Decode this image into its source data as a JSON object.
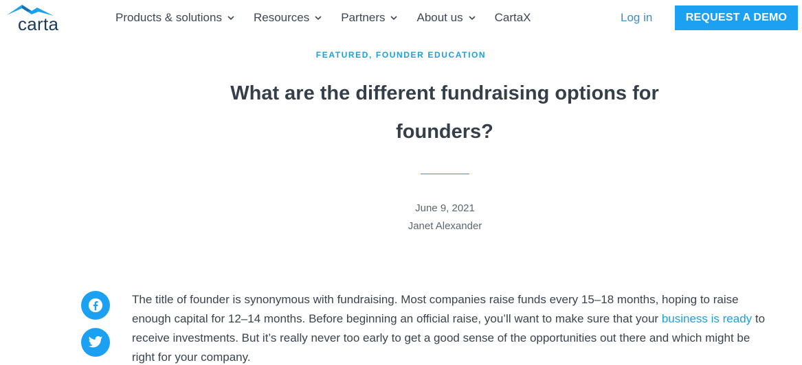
{
  "brand": {
    "name": "carta",
    "icon": "carta-logo-icon",
    "color": "#1b3b5a"
  },
  "nav": {
    "items": [
      {
        "label": "Products & solutions",
        "has_dropdown": true
      },
      {
        "label": "Resources",
        "has_dropdown": true
      },
      {
        "label": "Partners",
        "has_dropdown": true
      },
      {
        "label": "About us",
        "has_dropdown": true
      },
      {
        "label": "CartaX",
        "has_dropdown": false
      }
    ],
    "login_label": "Log in",
    "demo_label": "REQUEST A DEMO"
  },
  "article": {
    "category": "FEATURED, FOUNDER EDUCATION",
    "title_line1": "What are the different fundraising options for",
    "title_line2": "founders?",
    "date": "June 9, 2021",
    "author": "Janet Alexander",
    "body_before_link": "The title of founder is synonymous with fundraising. Most companies raise funds every 15–18 months, hoping to raise enough capital for 12–14 months. Before beginning an official raise, you’ll want to make sure that your ",
    "body_link": "business is ready",
    "body_after_link": " to receive investments. But it’s really never too early to get a good sense of the opportunities out there and which might be right for your company."
  },
  "social": [
    {
      "icon": "facebook-icon"
    },
    {
      "icon": "twitter-icon"
    }
  ],
  "colors": {
    "accent": "#1ca0f2",
    "link": "#1ca0d9",
    "heading": "#353f4a"
  }
}
